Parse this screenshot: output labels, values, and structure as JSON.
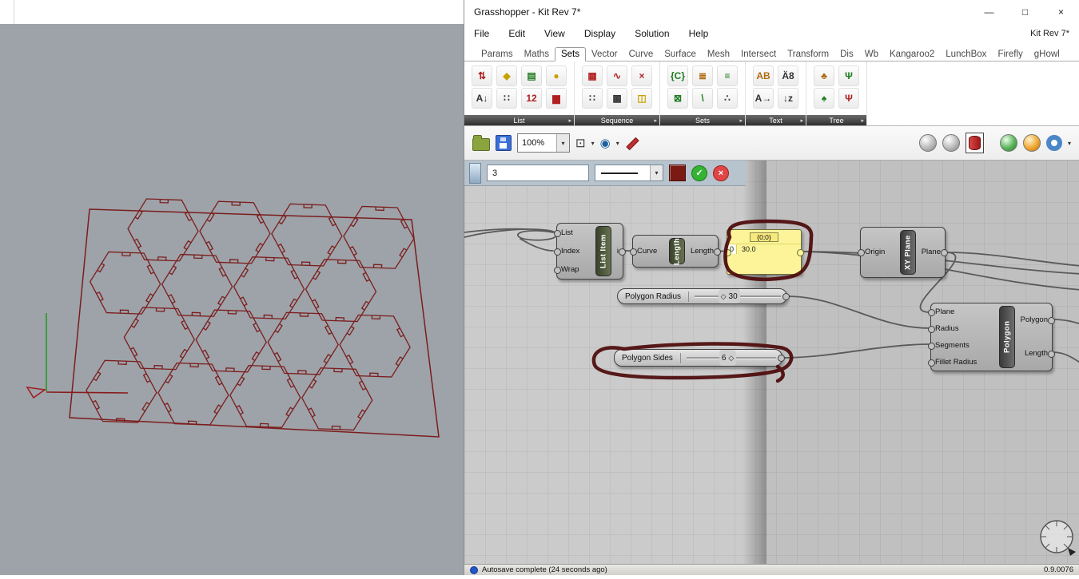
{
  "window": {
    "title": "Grasshopper - Kit Rev 7*",
    "doc_label": "Kit Rev 7*",
    "buttons": {
      "minimize": "—",
      "maximize": "□",
      "close": "×"
    }
  },
  "menu": {
    "items": [
      "File",
      "Edit",
      "View",
      "Display",
      "Solution",
      "Help"
    ]
  },
  "tabs": {
    "items": [
      "Params",
      "Maths",
      "Sets",
      "Vector",
      "Curve",
      "Surface",
      "Mesh",
      "Intersect",
      "Transform",
      "Dis",
      "Wb",
      "Kangaroo2",
      "LunchBox",
      "Firefly",
      "gHowl"
    ],
    "active": "Sets"
  },
  "ribbon": {
    "arrow": "▸",
    "groups": [
      {
        "label": "List",
        "icons": [
          "⇅",
          "A↓",
          "◆",
          "∷",
          "▤",
          "12",
          "●",
          "▆"
        ]
      },
      {
        "label": "Sequence",
        "icons": [
          "▦",
          "∷",
          "∿",
          "▩",
          "×",
          "◫"
        ]
      },
      {
        "label": "Sets",
        "icons": [
          "{C}",
          "⊠",
          "≣",
          "\\",
          "≡",
          "∴"
        ]
      },
      {
        "label": "Text",
        "icons": [
          "AB",
          "A→",
          "Ä8",
          "↓z"
        ]
      },
      {
        "label": "Tree",
        "icons": [
          "♣",
          "♠",
          "Ψ",
          "Ψ"
        ]
      }
    ]
  },
  "canvas_toolbar": {
    "zoom": "100%",
    "caret": "▾",
    "icons": {
      "extents": "⊡",
      "eye": "◉"
    }
  },
  "sketch_toolbar": {
    "size": "3",
    "ok": "✓",
    "cancel": "×"
  },
  "canvas": {
    "components": {
      "list_item": {
        "title": "List Item",
        "inputs": [
          "List",
          "Index",
          "Wrap"
        ],
        "outputs": [
          "i"
        ]
      },
      "length": {
        "title": "Length",
        "inputs": [
          "Curve"
        ],
        "outputs": [
          "Length"
        ]
      },
      "panel": {
        "path": "{0;0}",
        "rows": [
          {
            "index": "0",
            "value": "30.0"
          }
        ]
      },
      "xy_plane": {
        "title": "XY Plane",
        "inputs": [
          "Origin"
        ],
        "outputs": [
          "Plane"
        ]
      },
      "polygon": {
        "title": "Polygon",
        "inputs": [
          "Plane",
          "Radius",
          "Segments",
          "Fillet Radius"
        ],
        "outputs": [
          "Polygon",
          "Length"
        ]
      },
      "slider_radius": {
        "label": "Polygon Radius",
        "value": "30",
        "handle": "◇"
      },
      "slider_sides": {
        "label": "Polygon Sides",
        "value": "6",
        "handle": "◇"
      }
    }
  },
  "status": {
    "autosave": "Autosave complete (24 seconds ago)",
    "version": "0.9.0076"
  },
  "colors": {
    "annotation": "#4f0e0e",
    "sketch_swatch": "#7a1a12",
    "wire": "#5a5a5a",
    "hex_outline": "#7c1d1d",
    "panel_yellow": "#fdf49a"
  }
}
